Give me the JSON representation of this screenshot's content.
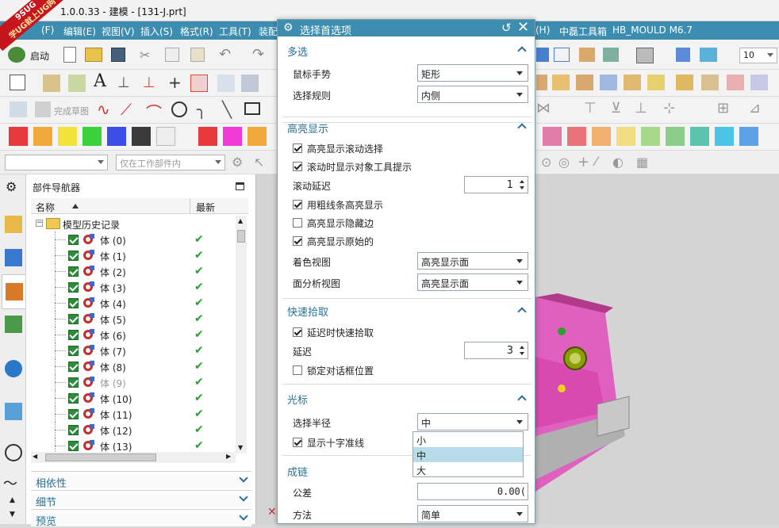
{
  "window": {
    "title": "1.0.0.33 - 建模 - [131-J.prt]",
    "watermark_line1": "9SUG",
    "watermark_line2": "学UG就上UG网"
  },
  "menubar": {
    "items_left": [
      "(F)",
      "编辑(E)",
      "视图(V)",
      "插入(S)",
      "格式(R)",
      "工具(T)",
      "装配"
    ],
    "items_right": [
      "(H)",
      "中磊工具箱",
      "HB_MOULD M6.7"
    ]
  },
  "toolbar": {
    "start_label": "启动",
    "finish_sketch_label": "完成草图",
    "zoom_value": "10",
    "filter_placeholder": "仅在工作部件内",
    "colors": [
      "#e8393b",
      "#f2a93b",
      "#f2e33b",
      "#3bd13b",
      "#3b4ee8",
      "#3b3b3b",
      "#eeeeee",
      "#e8393b",
      "#f03bd8",
      "#f2a93b",
      "#e07ca8",
      "#e8747a",
      "#f2b06e",
      "#f2de80",
      "#a8d98a",
      "#8ccd8a",
      "#5dc4b0",
      "#4cc4e8",
      "#5ca0e8"
    ]
  },
  "navigator": {
    "title": "部件导航器",
    "col_name": "名称",
    "col_latest": "最新",
    "root": "模型历史记录",
    "rows": [
      {
        "label": "体 (0)",
        "dim": false
      },
      {
        "label": "体 (1)",
        "dim": false
      },
      {
        "label": "体 (2)",
        "dim": false
      },
      {
        "label": "体 (3)",
        "dim": false
      },
      {
        "label": "体 (4)",
        "dim": false
      },
      {
        "label": "体 (5)",
        "dim": false
      },
      {
        "label": "体 (6)",
        "dim": false
      },
      {
        "label": "体 (7)",
        "dim": false
      },
      {
        "label": "体 (8)",
        "dim": false
      },
      {
        "label": "体 (9)",
        "dim": true
      },
      {
        "label": "体 (10)",
        "dim": false
      },
      {
        "label": "体 (11)",
        "dim": false
      },
      {
        "label": "体 (12)",
        "dim": false
      },
      {
        "label": "体 (13)",
        "dim": false
      }
    ],
    "sections": [
      "相依性",
      "细节",
      "预览"
    ]
  },
  "dialog": {
    "title": "选择首选项",
    "multi_select": {
      "header": "多选",
      "mouse_gesture_label": "鼠标手势",
      "mouse_gesture_value": "矩形",
      "select_rule_label": "选择规则",
      "select_rule_value": "内侧"
    },
    "highlight": {
      "header": "高亮显示",
      "scroll_select": "高亮显示滚动选择",
      "scroll_tooltip": "滚动时显示对象工具提示",
      "scroll_delay_label": "滚动延迟",
      "scroll_delay_value": "1",
      "thick_lines": "用粗线条高亮显示",
      "hidden_edges": "高亮显示隐藏边",
      "original": "高亮显示原始的",
      "shaded_view_label": "着色视图",
      "shaded_view_value": "高亮显示面",
      "face_analysis_label": "面分析视图",
      "face_analysis_value": "高亮显示面"
    },
    "quick_pick": {
      "header": "快速拾取",
      "delay_quick_pick": "延迟时快速拾取",
      "delay_label": "延迟",
      "delay_value": "3",
      "lock_dialog_pos": "锁定对话框位置"
    },
    "cursor": {
      "header": "光标",
      "radius_label": "选择半径",
      "radius_value": "中",
      "show_crosshair": "显示十字准线",
      "options": [
        "小",
        "中",
        "大"
      ]
    },
    "chaining": {
      "header": "成链",
      "tolerance_label": "公差",
      "tolerance_value": "0.00(",
      "method_label": "方法",
      "method_value": "简单"
    }
  }
}
